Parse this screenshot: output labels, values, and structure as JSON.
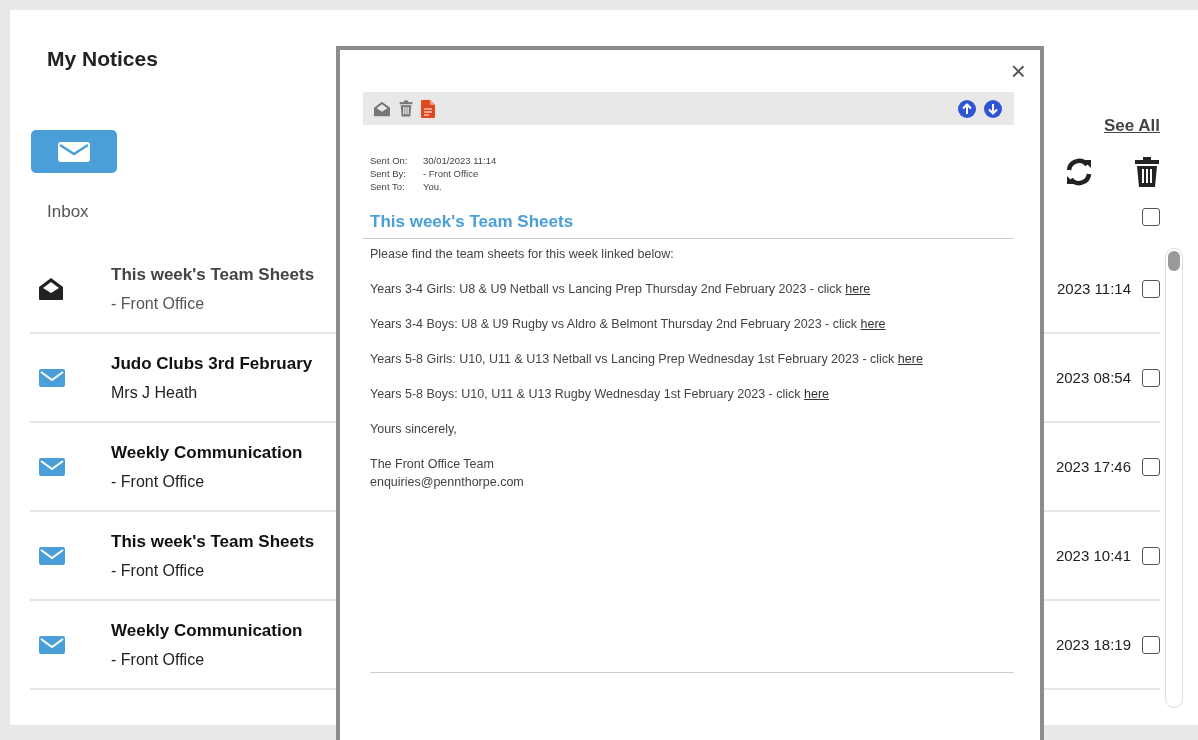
{
  "page": {
    "title": "My Notices",
    "folder": "Inbox",
    "see_all": "See All",
    "select_all": {
      "checked": false
    }
  },
  "notices": [
    {
      "title": "This week's Team Sheets",
      "sender": "- Front Office",
      "date": "2023 11:14",
      "read": true,
      "checked": false
    },
    {
      "title": "Judo Clubs 3rd February",
      "sender": "Mrs J Heath",
      "date": "2023 08:54",
      "read": false,
      "checked": false
    },
    {
      "title": "Weekly Communication",
      "sender": "- Front Office",
      "date": "2023 17:46",
      "read": false,
      "checked": false
    },
    {
      "title": "This week's Team Sheets",
      "sender": "- Front Office",
      "date": "2023 10:41",
      "read": false,
      "checked": false
    },
    {
      "title": "Weekly Communication",
      "sender": "- Front Office",
      "date": "2023 18:19",
      "read": false,
      "checked": false
    }
  ],
  "modal": {
    "close": "×",
    "meta": [
      {
        "label": "Sent On:",
        "value": "30/01/2023 11:14"
      },
      {
        "label": "Sent By:",
        "value": "- Front Office"
      },
      {
        "label": "Sent To:",
        "value": "You."
      }
    ],
    "title": "This week's Team Sheets",
    "paragraphs": [
      {
        "text": "Please find the team sheets for this week linked below:"
      },
      {
        "text": "Years 3-4 Girls: U8 & U9 Netball vs Lancing Prep Thursday 2nd February 2023 - click",
        "link": "here"
      },
      {
        "text": "Years 3-4 Boys: U8 & U9 Rugby vs Aldro & Belmont Thursday 2nd February 2023 - click",
        "link": "here"
      },
      {
        "text": "Years 5-8 Girls: U10, U11 & U13 Netball vs Lancing Prep Wednesday 1st February 2023 - click",
        "link": "here"
      },
      {
        "text": "Years 5-8 Boys: U10, U11 & U13 Rugby Wednesday 1st February 2023 - click",
        "link": "here"
      },
      {
        "text": "Yours sincerely,"
      }
    ],
    "signature": [
      "The Front Office Team",
      "enquiries@pennthorpe.com"
    ]
  }
}
